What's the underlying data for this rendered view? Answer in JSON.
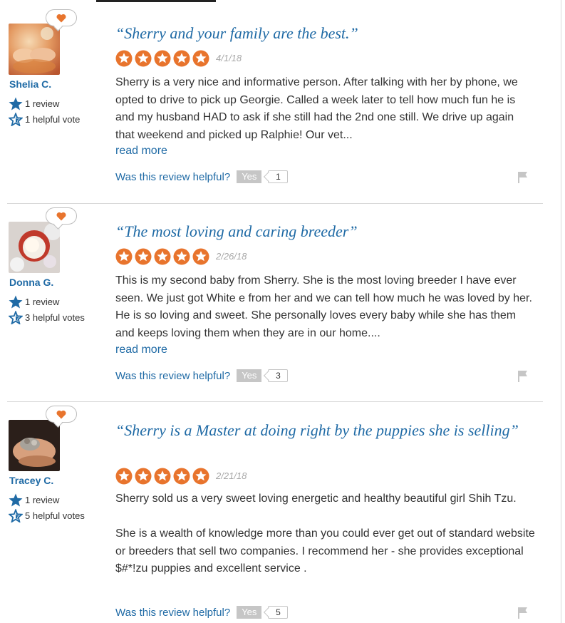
{
  "colors": {
    "link": "#1f6aa5",
    "star_orange": "#e8742d",
    "heart": "#e8742d",
    "muted": "#a8a8a8"
  },
  "helpful_prompt": "Was this review helpful?",
  "yes_label": "Yes",
  "read_more_label": "read more",
  "reviews": [
    {
      "user": {
        "name": "Shelia C.",
        "reviews": "1 review",
        "helpful_votes": "1 helpful vote"
      },
      "title": "“Sherry and your family are the best.”",
      "rating": 5,
      "date": "4/1/18",
      "body": [
        "Sherry is a very nice and informative person. After talking with her by phone, we opted to drive to pick up Georgie. Called a week later to tell how much fun he is and my husband HAD to ask if she still had the 2nd one still. We drive up again that weekend and picked up Ralphie! Our vet..."
      ],
      "helpful_count": "1"
    },
    {
      "user": {
        "name": "Donna G.",
        "reviews": "1 review",
        "helpful_votes": "3 helpful votes"
      },
      "title": "“The most loving and caring breeder”",
      "rating": 5,
      "date": "2/26/18",
      "body": [
        "This is my second baby from Sherry. She is the most loving breeder I have ever seen. We just got White e from her and we can tell how much he was loved by her. He is so loving and sweet. She personally loves every baby while she has them and keeps loving them when they are in our home...."
      ],
      "helpful_count": "3"
    },
    {
      "user": {
        "name": "Tracey C.",
        "reviews": "1 review",
        "helpful_votes": "5 helpful votes"
      },
      "title": "“Sherry is a Master at doing right by the puppies she is selling”",
      "rating": 5,
      "date": "2/21/18",
      "body": [
        "Sherry sold us a very sweet loving energetic and healthy beautiful girl Shih Tzu.",
        "She is a wealth of knowledge more than you could ever get out of standard website or breeders that sell two companies. I recommend her - she provides exceptional $#*!zu puppies and excellent service ."
      ],
      "helpful_count": "5"
    }
  ]
}
